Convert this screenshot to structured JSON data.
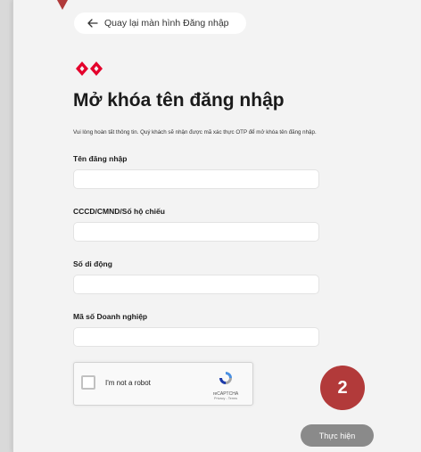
{
  "header": {
    "back_label": "Quay lại màn hình Đăng nhập",
    "title": "Mở khóa tên đăng nhập",
    "description": "Vui lòng hoàn tất thông tin. Quý khách sẽ nhận được mã xác thực OTP để mở khóa tên đăng nhập."
  },
  "form": {
    "username_label": "Tên đăng nhập",
    "id_label": "CCCD/CMND/Số hộ chiếu",
    "phone_label": "Số di động",
    "tax_label": "Mã số Doanh nghiệp"
  },
  "captcha": {
    "label": "I'm not a robot",
    "brand": "reCAPTCHA",
    "links": "Privacy - Terms"
  },
  "annotation": {
    "step": "2"
  },
  "actions": {
    "submit_label": "Thực hiện"
  },
  "colors": {
    "accent": "#e4002b",
    "badge": "#b23a3a",
    "submit_disabled": "#8a8a8a"
  },
  "icons": {
    "back": "arrow-left-icon",
    "logo": "diamond-logo-icon",
    "captcha": "recaptcha-icon"
  }
}
